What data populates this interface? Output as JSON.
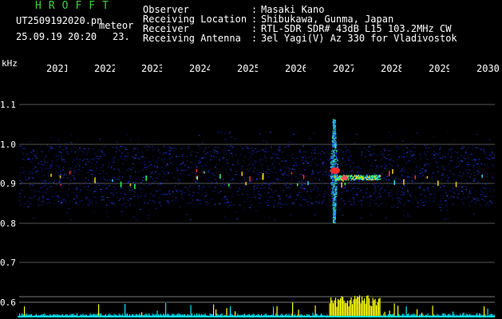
{
  "header": {
    "brand": "HROFFT",
    "filename": "UT2509192020.pn",
    "filename_suffix": "meteor",
    "date_time": "25.09.19 20:20",
    "count": "23."
  },
  "meta": [
    {
      "label": "Observer",
      "value": "Masaki Kano"
    },
    {
      "label": "Receiving Location",
      "value": "Shibukawa, Gunma, Japan"
    },
    {
      "label": "Receiver",
      "value": "RTL-SDR SDR# 43dB L15 103.2MHz CW"
    },
    {
      "label": "Receiving Antenna",
      "value": "3el Yagi(V) Az 330 for Vladivostok"
    }
  ],
  "meta_separator": ":",
  "axis": {
    "y_unit": "kHz",
    "y_ticks": [
      "1.1",
      "1.0",
      "0.9",
      "0.8",
      "0.7",
      "0.6"
    ],
    "time_ticks": [
      "2021",
      "2022",
      "2023",
      "2024",
      "2025",
      "2026",
      "2027",
      "2028",
      "2029",
      "2030"
    ]
  },
  "colors": {
    "background": "#000000",
    "brand": "#3ad13a",
    "noise": "#2a3cff",
    "echo": "#ff2a2a",
    "power": "#ffff00",
    "baseline": "#00e5ff"
  }
}
